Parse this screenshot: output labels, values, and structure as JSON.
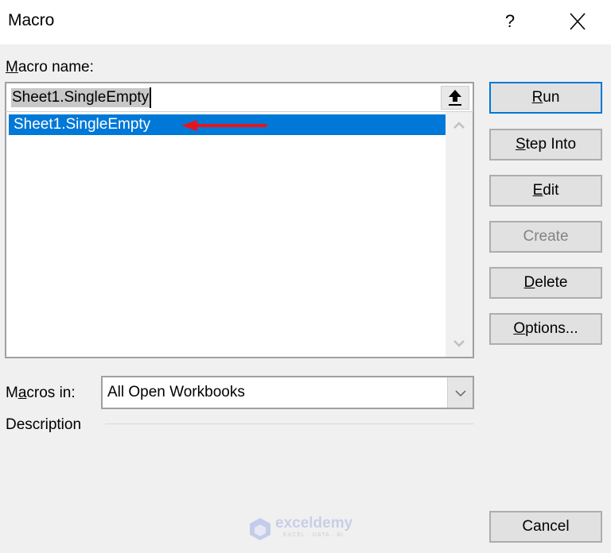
{
  "window": {
    "title": "Macro",
    "help_icon": "?",
    "close_icon": "close-icon"
  },
  "macro_name": {
    "label_accel": "M",
    "label_rest": "acro name:",
    "value": "Sheet1.SingleEmpty",
    "upload_icon": "upload-arrow-icon"
  },
  "macro_list": {
    "items": [
      {
        "label": "Sheet1.SingleEmpty",
        "selected": true
      }
    ],
    "annotation": "red-arrow-pointing-left"
  },
  "buttons": {
    "run": {
      "accel": "R",
      "rest": "un"
    },
    "step_into": {
      "accel": "S",
      "rest": "tep Into"
    },
    "edit": {
      "accel": "E",
      "rest": "dit"
    },
    "create": {
      "label": "Create",
      "disabled": true
    },
    "delete": {
      "accel": "D",
      "rest": "elete"
    },
    "options": {
      "accel": "O",
      "rest": "ptions..."
    },
    "cancel": {
      "label": "Cancel"
    }
  },
  "macros_in": {
    "label_pre": "M",
    "label_accel": "a",
    "label_rest": "cros in:",
    "value": "All Open Workbooks"
  },
  "description": {
    "label": "Description"
  },
  "watermark": {
    "brand": "exceldemy",
    "tagline": "EXCEL · DATA · BI"
  },
  "colors": {
    "selection": "#0078d7",
    "annotation_arrow": "#e8141c",
    "dialog_bg": "#f0f0f0"
  }
}
